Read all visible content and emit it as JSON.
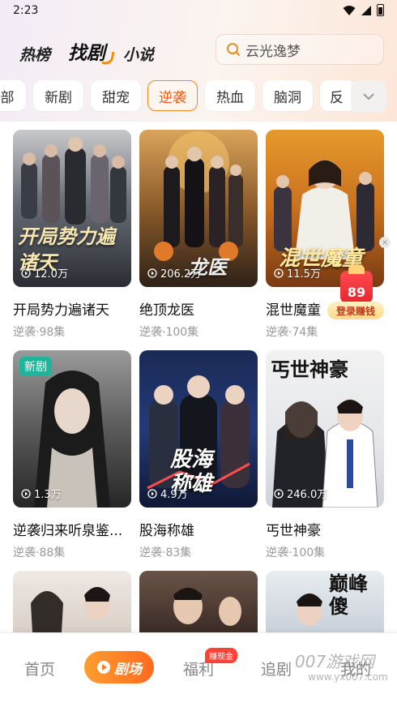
{
  "status_bar": {
    "time": "2:23"
  },
  "header": {
    "tabs": [
      {
        "label": "热榜"
      },
      {
        "label": "找剧"
      },
      {
        "label": "小说"
      }
    ],
    "search": {
      "placeholder": "云光逸梦"
    }
  },
  "categories": {
    "chips": [
      {
        "label": "部"
      },
      {
        "label": "新剧"
      },
      {
        "label": "甜宠"
      },
      {
        "label": "逆袭"
      },
      {
        "label": "热血"
      },
      {
        "label": "脑洞"
      },
      {
        "label": "反"
      }
    ],
    "active": "逆袭"
  },
  "cards": [
    {
      "title": "开局势力遍诸天",
      "genre": "逆袭",
      "episodes": "98集",
      "meta": "逆袭·98集",
      "views": "12.0万",
      "poster_text": "开局势力遍诸天",
      "badge": ""
    },
    {
      "title": "绝顶龙医",
      "genre": "逆袭",
      "episodes": "100集",
      "meta": "逆袭·100集",
      "views": "206.2万",
      "poster_text": "龙医",
      "badge": ""
    },
    {
      "title": "混世魔童",
      "genre": "逆袭",
      "episodes": "74集",
      "meta": "逆袭·74集",
      "views": "11.5万",
      "poster_text": "混世魔童",
      "badge": ""
    },
    {
      "title": "逆袭归来听泉鉴...",
      "genre": "逆袭",
      "episodes": "88集",
      "meta": "逆袭·88集",
      "views": "1.3万",
      "poster_text": "",
      "badge": "新剧"
    },
    {
      "title": "股海称雄",
      "genre": "逆袭",
      "episodes": "83集",
      "meta": "逆袭·83集",
      "views": "4.9万",
      "poster_text": "股海称雄",
      "badge": ""
    },
    {
      "title": "丐世神豪",
      "genre": "逆袭",
      "episodes": "100集",
      "meta": "逆袭·100集",
      "views": "246.0万",
      "poster_text": "丐世神豪",
      "badge": ""
    },
    {
      "title": "",
      "meta": "",
      "views": "",
      "poster_text": "",
      "badge": ""
    },
    {
      "title": "",
      "meta": "",
      "views": "",
      "poster_text": "",
      "badge": ""
    },
    {
      "title": "",
      "meta": "",
      "views": "",
      "poster_text": "巅峰傻",
      "badge": ""
    }
  ],
  "promo": {
    "number": "89",
    "label": "登录赚钱"
  },
  "bottom_nav": {
    "items": [
      {
        "label": "首页"
      },
      {
        "label": "剧场"
      },
      {
        "label": "福利"
      },
      {
        "label": "追剧"
      },
      {
        "label": "我的"
      }
    ],
    "cash_badge": "赚现金"
  },
  "watermark": {
    "brand": "007游戏网",
    "url": "www.yx007.com"
  },
  "colors": {
    "accent": "#ff7a1f",
    "active_chip_text": "#f05a14",
    "new_badge": "#1fb59a",
    "promo_red": "#e7262f"
  }
}
